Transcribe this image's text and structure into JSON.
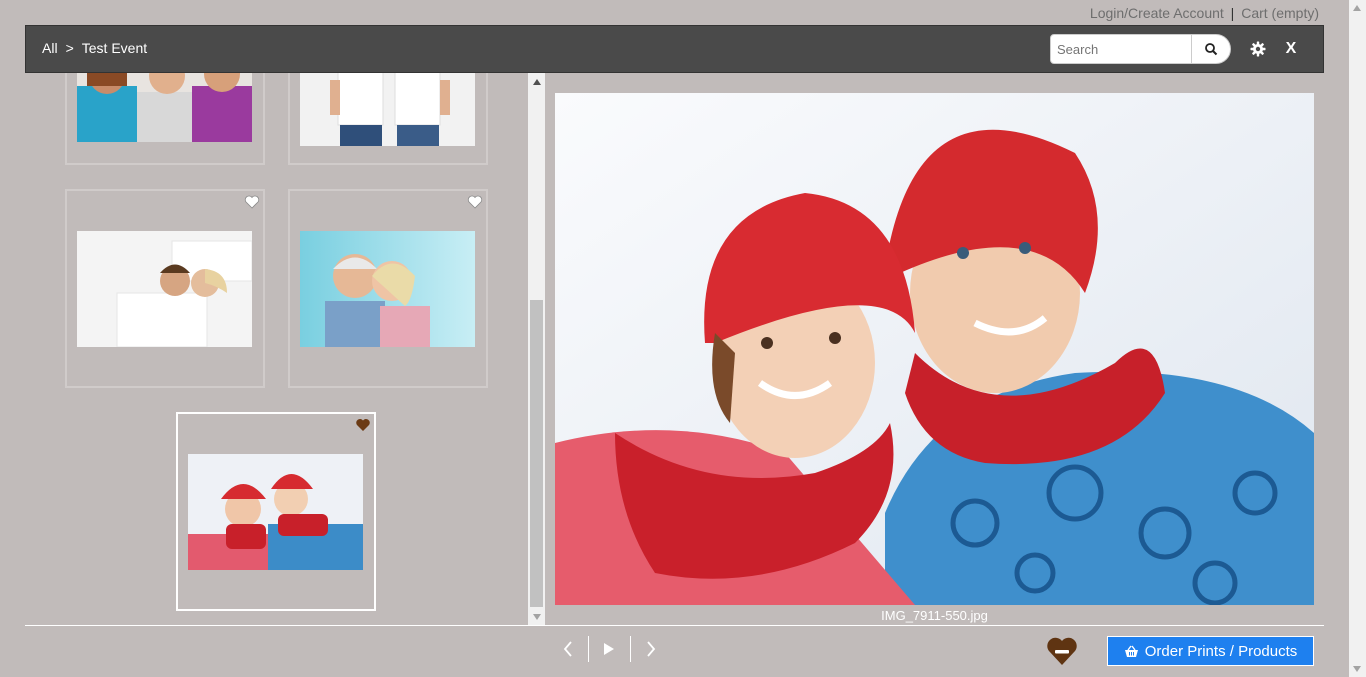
{
  "top_links": {
    "login": "Login/Create Account",
    "separator": "|",
    "cart": "Cart (empty)"
  },
  "header": {
    "breadcrumb_all": "All",
    "breadcrumb_arrow": ">",
    "breadcrumb_event": "Test Event",
    "search_placeholder": "Search",
    "close_label": "X"
  },
  "gallery": {
    "thumbnails": [
      {
        "name": "group-friends",
        "favorite": false
      },
      {
        "name": "couple-white-shirts",
        "favorite": false
      },
      {
        "name": "couple-lying-floor",
        "favorite": false
      },
      {
        "name": "elderly-couple",
        "favorite": false
      },
      {
        "name": "winter-couple",
        "favorite": true,
        "selected": true
      }
    ]
  },
  "viewer": {
    "filename": "IMG_7911-550.jpg"
  },
  "actions": {
    "order_label": "Order Prints / Products"
  },
  "colors": {
    "accent": "#1e80ef",
    "heart_active": "#6b3a14",
    "header_bg": "#4a4a4a"
  },
  "icons": [
    "search-icon",
    "gear-icon",
    "heart-icon",
    "chevron-left-icon",
    "play-icon",
    "chevron-right-icon",
    "basket-icon",
    "heart-minus-icon"
  ]
}
